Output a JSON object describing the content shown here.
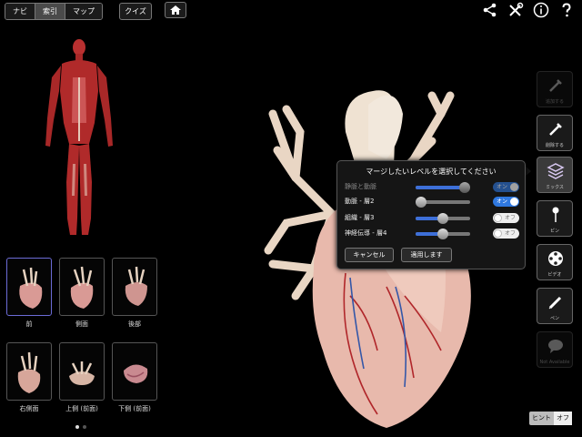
{
  "nav": {
    "tabs": [
      {
        "label": "ナビ"
      },
      {
        "label": "索引"
      },
      {
        "label": "マップ"
      }
    ],
    "quiz_label": "クイズ"
  },
  "top_icons": [
    "share-icon",
    "tools-icon",
    "info-icon",
    "help-icon"
  ],
  "views": [
    {
      "label": "前"
    },
    {
      "label": "側面"
    },
    {
      "label": "後部"
    },
    {
      "label": "右側面"
    },
    {
      "label": "上側 (前面)"
    },
    {
      "label": "下側 (前面)"
    }
  ],
  "tools": [
    {
      "label": "追加する"
    },
    {
      "label": "削除する"
    },
    {
      "label": "ミックス"
    },
    {
      "label": "ピン"
    },
    {
      "label": "ビデオ"
    },
    {
      "label": "ペン"
    },
    {
      "label": "Not Available"
    }
  ],
  "mix_popover": {
    "title": "マージしたいレベルを選択してください",
    "rows": [
      {
        "label": "静脈と動脈",
        "toggle": "オン",
        "level": 0.9
      },
      {
        "label": "動脈 - 層2",
        "toggle": "オン",
        "level": 0.1
      },
      {
        "label": "組織 - 層3",
        "toggle": "オフ",
        "level": 0.5
      },
      {
        "label": "神経伝導 - 層4",
        "toggle": "オフ",
        "level": 0.5
      }
    ],
    "cancel_label": "キャンセル",
    "apply_label": "適用します"
  },
  "hint": {
    "label": "ヒント",
    "state": "オフ"
  },
  "colors": {
    "accent": "#2f78e0",
    "muscle": "#b02a2a",
    "heart": "#e6b9ad"
  }
}
